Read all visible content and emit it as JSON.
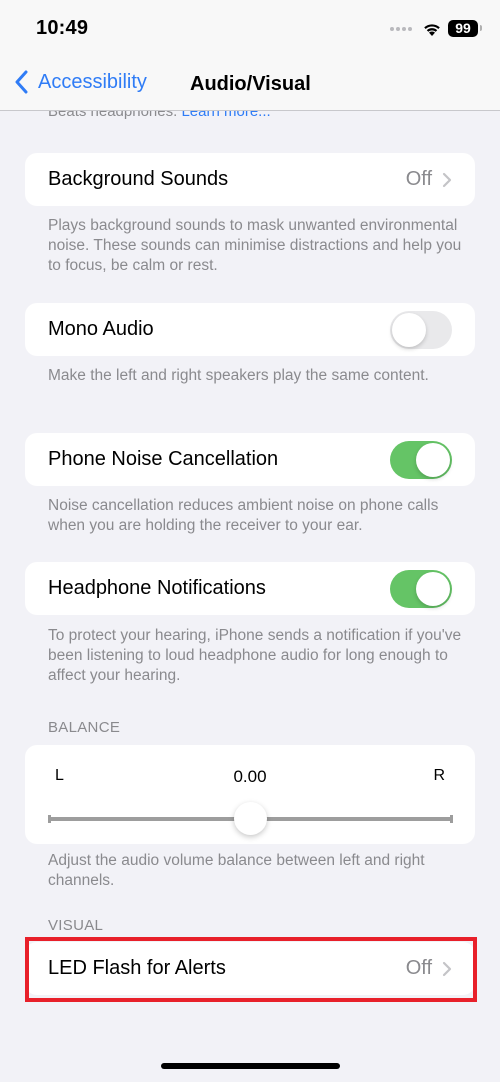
{
  "status_bar": {
    "time": "10:49",
    "battery": "99",
    "icons": [
      "cellular-signal-icon",
      "wifi-icon",
      "battery-icon"
    ]
  },
  "nav": {
    "back_label": "Accessibility",
    "title": "Audio/Visual",
    "back_icon": "chevron-left-icon"
  },
  "cutoff_text": {
    "text": "Beats headphones. ",
    "link": "Learn more..."
  },
  "settings": {
    "background_sounds": {
      "label": "Background Sounds",
      "value": "Off",
      "footer": "Plays background sounds to mask unwanted environmental noise. These sounds can minimise distractions and help you to focus, be calm or rest."
    },
    "mono_audio": {
      "label": "Mono Audio",
      "enabled": false,
      "footer": "Make the left and right speakers play the same content."
    },
    "phone_noise_cancellation": {
      "label": "Phone Noise Cancellation",
      "enabled": true,
      "footer": "Noise cancellation reduces ambient noise on phone calls when you are holding the receiver to your ear."
    },
    "headphone_notifications": {
      "label": "Headphone Notifications",
      "enabled": true,
      "footer": "To protect your hearing, iPhone sends a notification if you've been listening to loud headphone audio for long enough to affect your hearing."
    }
  },
  "balance": {
    "header": "BALANCE",
    "left_label": "L",
    "right_label": "R",
    "value_text": "0.00",
    "value": 0.0,
    "range": [
      -1,
      1
    ],
    "footer": "Adjust the audio volume balance between left and right channels."
  },
  "visual": {
    "header": "VISUAL",
    "led_flash": {
      "label": "LED Flash for Alerts",
      "value": "Off"
    }
  },
  "colors": {
    "accent": "#2f7cf6",
    "toggle_on": "#65c466",
    "toggle_off": "#e9e9eb",
    "highlight": "#e8202a",
    "secondary_text": "#8a8a8e",
    "background": "#f2f2f7"
  }
}
